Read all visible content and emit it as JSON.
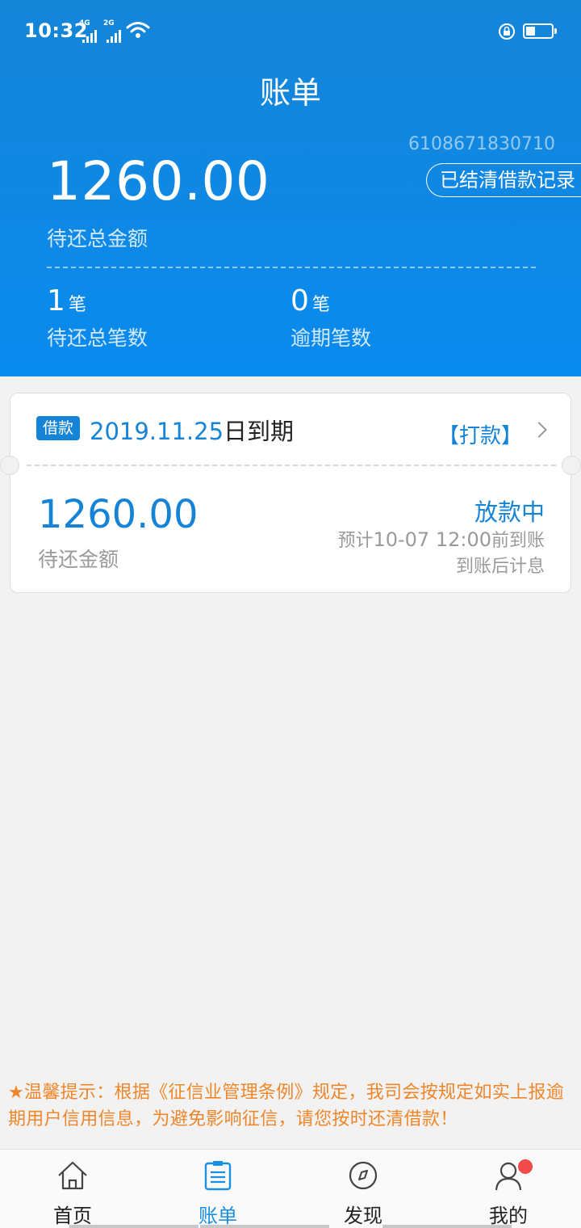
{
  "status_bar": {
    "time": "10:32",
    "signal1_label": "4G",
    "signal2_label": "2G"
  },
  "header": {
    "title": "账单",
    "account_number": "6108671830710",
    "settled_records_button": "已结清借款记录",
    "total_amount": "1260.00",
    "total_amount_label": "待还总金额",
    "pending_count": "1",
    "pending_unit": "笔",
    "pending_label": "待还总笔数",
    "overdue_count": "0",
    "overdue_unit": "笔",
    "overdue_label": "逾期笔数"
  },
  "loan_card": {
    "badge": "借款",
    "due_date": "2019.11.25",
    "due_suffix": "日到期",
    "action_link": "【打款】",
    "amount": "1260.00",
    "amount_label": "待还金额",
    "status": "放款中",
    "eta_prefix": "预计",
    "eta_time": "10-07 12:00",
    "eta_suffix": "前到账",
    "interest_note": "到账后计息"
  },
  "notice": "★温馨提示：根据《征信业管理条例》规定，我司会按规定如实上报逾期用户信用信息，为避免影响征信，请您按时还清借款！",
  "tabbar": {
    "tabs": [
      {
        "label": "首页",
        "icon": "home-icon",
        "active": false
      },
      {
        "label": "账单",
        "icon": "bill-icon",
        "active": true
      },
      {
        "label": "发现",
        "icon": "compass-icon",
        "active": false
      },
      {
        "label": "我的",
        "icon": "user-icon",
        "active": false
      }
    ]
  },
  "colors": {
    "header_blue": "#1585d8",
    "accent_blue": "#1583d6",
    "notice_orange": "#f0862a",
    "badge_red": "#f24a4a"
  }
}
